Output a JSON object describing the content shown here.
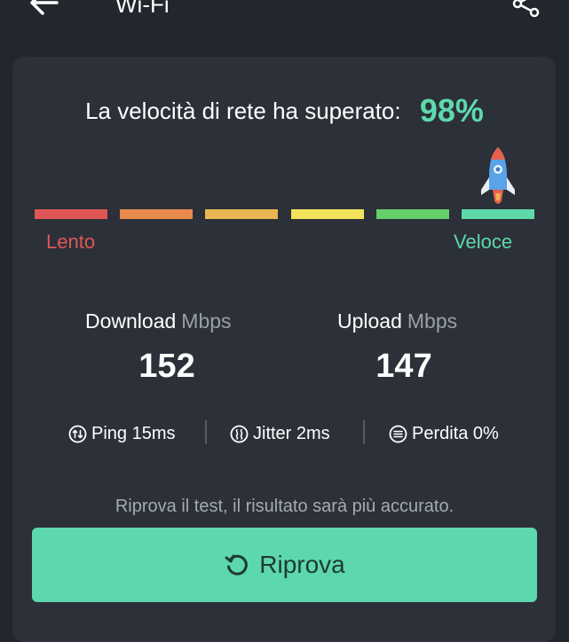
{
  "header": {
    "title": "Wi-Fi",
    "back_icon": "back-arrow-icon",
    "share_icon": "share-icon"
  },
  "result": {
    "headline": "La velocità di rete ha superato:",
    "percentile": "98%"
  },
  "scale": {
    "slow_label": "Lento",
    "fast_label": "Veloce",
    "segment_colors": [
      "#e05656",
      "#e98a4e",
      "#e9b64f",
      "#f3e35a",
      "#66cf6a",
      "#5fd9aa"
    ],
    "marker_icon": "rocket-icon",
    "slow_color": "#e05656",
    "fast_color": "#5ed9ad"
  },
  "stats": {
    "download": {
      "label": "Download",
      "unit": "Mbps",
      "value": "152"
    },
    "upload": {
      "label": "Upload",
      "unit": "Mbps",
      "value": "147"
    }
  },
  "metrics": [
    {
      "icon": "ping-icon",
      "label": "Ping 15ms"
    },
    {
      "icon": "jitter-icon",
      "label": "Jitter 2ms"
    },
    {
      "icon": "packet-loss-icon",
      "label": "Perdita 0%"
    }
  ],
  "footer": {
    "hint": "Riprova il test, il risultato sarà più accurato.",
    "retry_label": "Riprova",
    "retry_icon": "retry-icon",
    "accent_color": "#5dd7ad"
  }
}
